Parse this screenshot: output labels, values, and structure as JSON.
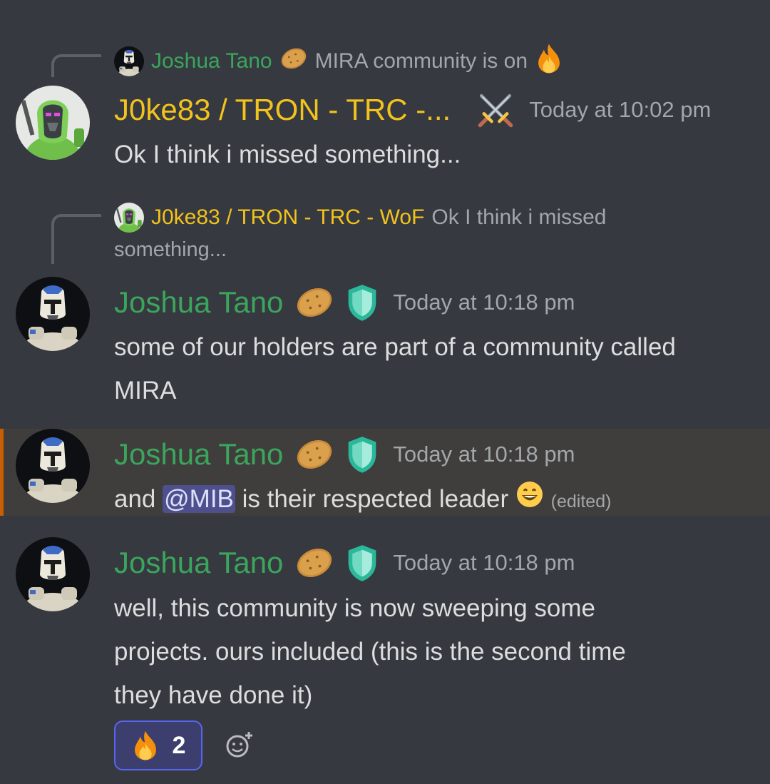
{
  "messages": [
    {
      "reply": {
        "author": "Joshua Tano",
        "text": "MIRA community is on"
      },
      "author": "J0ke83 / TRON - TRC -...",
      "timestamp": "Today at 10:02 pm",
      "lines": [
        "Ok I think i missed something..."
      ]
    },
    {
      "reply": {
        "author": "J0ke83 / TRON - TRC - WoF",
        "text_line1": "Ok I think i missed",
        "text_line2": "something..."
      },
      "author": "Joshua Tano",
      "timestamp": "Today at 10:18 pm",
      "lines": [
        "some of our holders are part of a community called",
        "MIRA"
      ]
    },
    {
      "author": "Joshua Tano",
      "timestamp": "Today at 10:18 pm",
      "text_before": "and",
      "mention": "@MIB",
      "text_after": "is their respected leader",
      "edited": "(edited)"
    },
    {
      "author": "Joshua Tano",
      "timestamp": "Today at 10:18 pm",
      "lines": [
        "well, this community is now sweeping some",
        "projects. ours included (this is the second time",
        "they have done it)"
      ],
      "reaction": {
        "emoji_icon": "fire-emoji",
        "count": "2"
      }
    }
  ],
  "colors": {
    "background": "#36393f",
    "highlight_border": "#c75e00",
    "mention_bg": "#4d508c",
    "green_name": "#3ba55c",
    "gold_name": "#f2c31c"
  }
}
